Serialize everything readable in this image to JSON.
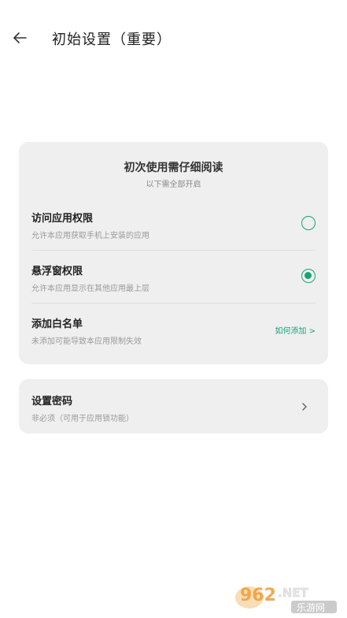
{
  "header": {
    "title": "初始设置（重要）"
  },
  "permissions_card": {
    "heading": "初次使用需仔细阅读",
    "subheading": "以下需全部开启",
    "items": [
      {
        "title": "访问应用权限",
        "description": "允许本应用获取手机上安装的应用",
        "checked": false
      },
      {
        "title": "悬浮窗权限",
        "description": "允许本应用显示在其他应用最上层",
        "checked": true
      },
      {
        "title": "添加白名单",
        "description": "未添加可能导致本应用限制失效",
        "action_label": "如何添加 >"
      }
    ]
  },
  "password_card": {
    "title": "设置密码",
    "description": "非必须（可用于应用锁功能）"
  },
  "watermark": {
    "brand": "962",
    "suffix": ".NET",
    "sub": "乐游网"
  },
  "colors": {
    "accent": "#1aa37a",
    "card_bg": "#efefef"
  },
  "icons": {
    "back": "arrow-left-icon",
    "chevron": "chevron-right-icon"
  }
}
